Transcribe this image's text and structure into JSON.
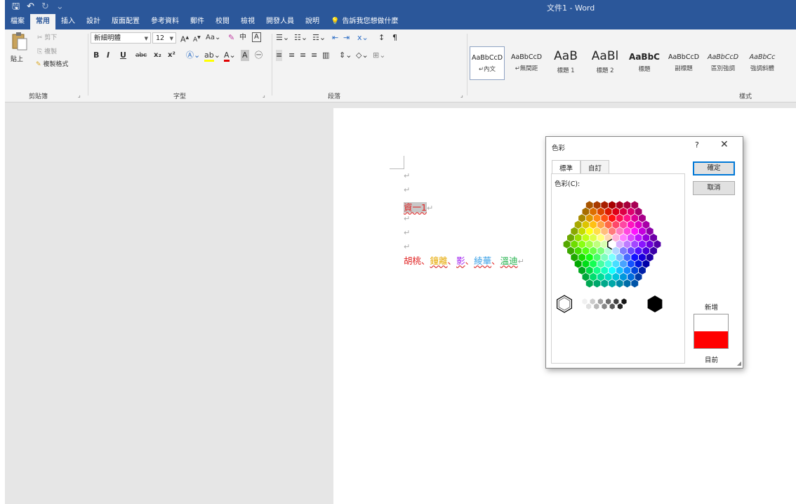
{
  "title_bar": {
    "doc_title": "文件1 - Word",
    "save_glyph": "🖫",
    "undo_glyph": "↶",
    "redo_glyph": "↻",
    "qat_more_glyph": "⌄"
  },
  "menu": {
    "tabs": [
      "檔案",
      "常用",
      "插入",
      "設計",
      "版面配置",
      "參考資料",
      "郵件",
      "校閱",
      "檢視",
      "開發人員",
      "說明"
    ],
    "active_tab": "常用",
    "tell_me": "告訴我您想做什麼"
  },
  "ribbon": {
    "clipboard": {
      "label": "剪貼簿",
      "paste": "貼上",
      "cut": "剪下",
      "copy": "複製",
      "format_painter": "複製格式"
    },
    "font": {
      "label": "字型",
      "font_name": "新細明體",
      "font_size": "12",
      "grow": "A",
      "shrink": "A",
      "case": "Aa",
      "phonetic": "中",
      "bold": "B",
      "italic": "I",
      "underline": "U",
      "strike": "abc",
      "subscript": "x₂",
      "superscript": "x²"
    },
    "paragraph": {
      "label": "段落"
    },
    "styles": {
      "label": "樣式",
      "items": [
        {
          "sample": "AaBbCcD",
          "name": "↵內文"
        },
        {
          "sample": "AaBbCcD",
          "name": "↵無間距"
        },
        {
          "sample": "AaB",
          "name": "標題 1"
        },
        {
          "sample": "AaBl",
          "name": "標題 2"
        },
        {
          "sample": "AaBbC",
          "name": "標題"
        },
        {
          "sample": "AaBbCcD",
          "name": "副標題"
        },
        {
          "sample": "AaBbCcD",
          "name": "區別強調"
        },
        {
          "sample": "AaBbCc",
          "name": "強調斜體"
        }
      ]
    }
  },
  "document": {
    "para_mark": "↵",
    "line1_text": "資一1",
    "line2_items": [
      {
        "text": "胡桃",
        "color": "#e02020"
      },
      {
        "text": "、",
        "color": "#e02020"
      },
      {
        "text": "鐘離",
        "color": "#e6a800"
      },
      {
        "text": "、",
        "color": "#e02020"
      },
      {
        "text": "影",
        "color": "#a020f0"
      },
      {
        "text": "、",
        "color": "#e02020"
      },
      {
        "text": "綾華",
        "color": "#3aa0e6"
      },
      {
        "text": "、",
        "color": "#e02020"
      },
      {
        "text": "溫迪",
        "color": "#22b14c"
      }
    ],
    "red_color": "#e02020"
  },
  "dialog": {
    "title": "色彩",
    "help": "?",
    "close": "✕",
    "tabs": [
      "標準",
      "自訂"
    ],
    "active_tab": "標準",
    "colors_label": "色彩(C):",
    "ok": "確定",
    "cancel": "取消",
    "new_label": "新增",
    "current_label": "目前",
    "new_color": "#ffffff",
    "current_color": "#ff0000"
  }
}
